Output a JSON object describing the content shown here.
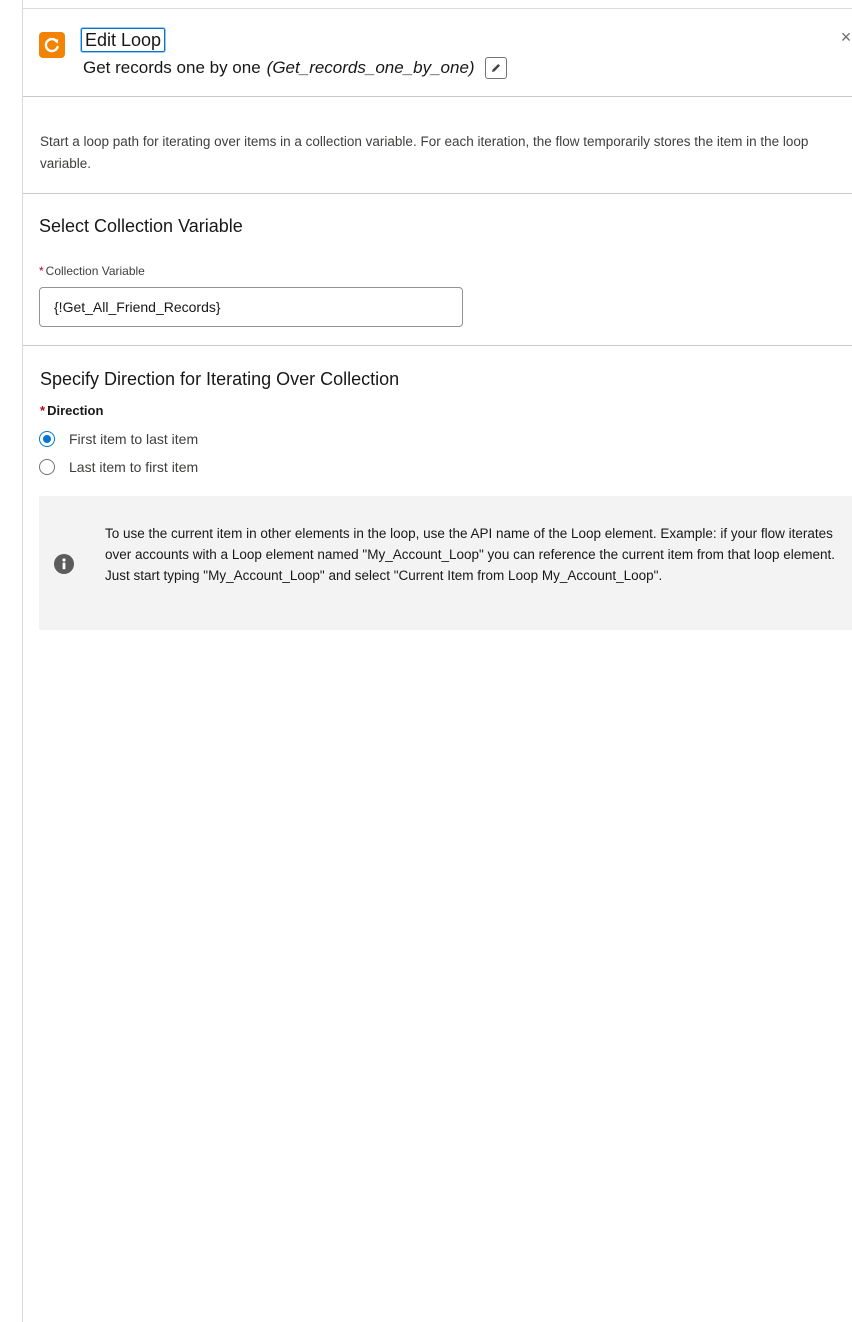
{
  "header": {
    "title": "Edit Loop",
    "element_label": "Get records one by one",
    "element_api_name": "(Get_records_one_by_one)",
    "close_glyph": "×",
    "icon": "loop-icon",
    "icon_color": "#f38303"
  },
  "description": "Start a loop path for iterating over items in a collection variable. For each iteration, the flow temporarily stores the item in the loop variable.",
  "collection_section": {
    "heading": "Select Collection Variable",
    "field_label": "Collection Variable",
    "required_marker": "*",
    "value": "{!Get_All_Friend_Records}"
  },
  "direction_section": {
    "heading": "Specify Direction for Iterating Over Collection",
    "field_label": "Direction",
    "required_marker": "*",
    "options": [
      {
        "label": "First item to last item",
        "checked": true
      },
      {
        "label": "Last item to first item",
        "checked": false
      }
    ]
  },
  "info": {
    "text": "To use the current item in other elements in the loop, use the API name of the Loop element. Example: if your flow iterates over accounts with a Loop element named \"My_Account_Loop\" you can reference the current item from that loop element. Just start typing \"My_Account_Loop\" and select \"Current Item from Loop My_Account_Loop\"."
  },
  "colors": {
    "accent_blue": "#0176d3",
    "required_red": "#ba0517",
    "info_bg": "#f3f3f3"
  }
}
